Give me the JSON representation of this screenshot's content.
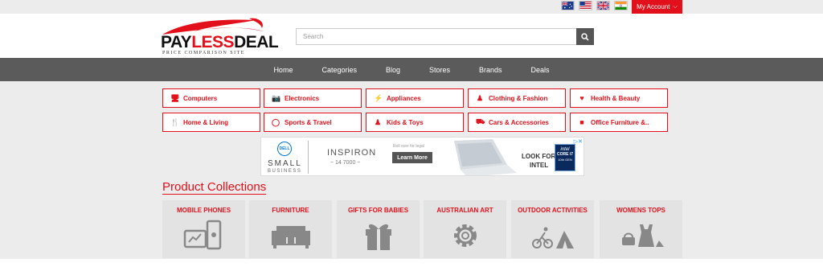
{
  "account": {
    "label": "My Account"
  },
  "flags": [
    "flag-au-icon",
    "flag-us-icon",
    "flag-uk-icon",
    "flag-in-icon"
  ],
  "logo": {
    "brand_a": "PAY",
    "brand_b": "LESS",
    "brand_c": "DEAL",
    "tagline": "PRICE COMPARISON SITE"
  },
  "search": {
    "placeholder": "Search"
  },
  "nav": {
    "items": [
      "Home",
      "Categories",
      "Blog",
      "Stores",
      "Brands",
      "Deals"
    ]
  },
  "categories": [
    {
      "label": "Computers",
      "icon": "monitor-icon"
    },
    {
      "label": "Electronics",
      "icon": "camera-icon"
    },
    {
      "label": "Appliances",
      "icon": "plug-icon"
    },
    {
      "label": "Clothing & Fashion",
      "icon": "person-icon"
    },
    {
      "label": "Health & Beauty",
      "icon": "heartbeat-icon"
    },
    {
      "label": "Home & Living",
      "icon": "cutlery-icon"
    },
    {
      "label": "Sports & Travel",
      "icon": "bicycle-icon"
    },
    {
      "label": "Kids & Toys",
      "icon": "child-icon"
    },
    {
      "label": "Cars & Accessories",
      "icon": "car-icon"
    },
    {
      "label": "Office Furniture &..",
      "icon": "folder-icon"
    }
  ],
  "ad": {
    "brand": "DELL",
    "small": "SMALL",
    "business": "BUSINESS",
    "product": "INSPIRON",
    "model": "~ 14 7000 ~",
    "legal": "Roll over for legal",
    "cta": "Learn More",
    "look": "LOOK FOR",
    "intel": "INTEL",
    "chip_a": "intel",
    "chip_b": "CORE i7",
    "chip_c": "10th GEN"
  },
  "collections_title": "Product Collections",
  "collections": [
    {
      "label": "MOBILE PHONES",
      "icon": "phone-tablet-icon"
    },
    {
      "label": "FURNITURE",
      "icon": "sofa-icon"
    },
    {
      "label": "GIFTS FOR BABIES",
      "icon": "gift-icon"
    },
    {
      "label": "AUSTRALIAN ART",
      "icon": "gear-icon"
    },
    {
      "label": "OUTDOOR ACTIVITIES",
      "icon": "outdoor-icon"
    },
    {
      "label": "WOMENS TOPS",
      "icon": "women-fashion-icon"
    }
  ],
  "colors": {
    "accent": "#e2101a",
    "nav": "#5b5b5b",
    "tile": "#e3e3e3"
  }
}
